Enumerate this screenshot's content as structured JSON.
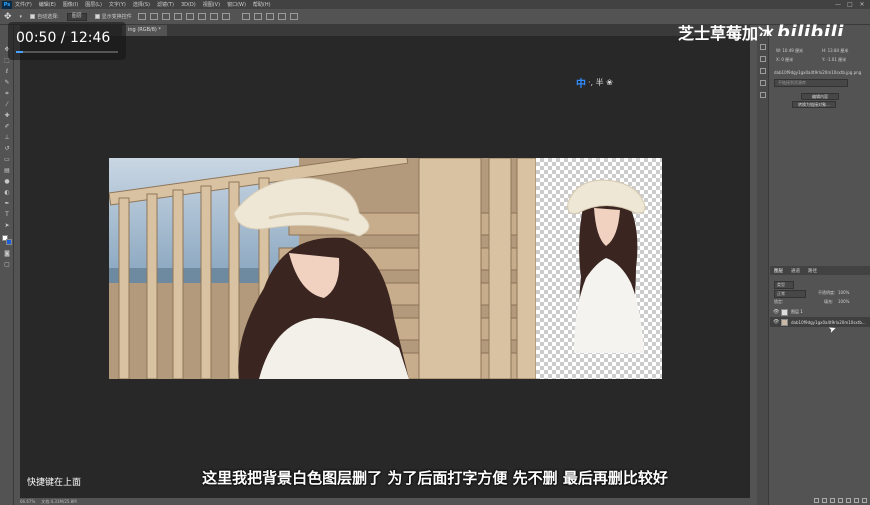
{
  "app": {
    "logo": "Ps"
  },
  "menu": [
    "文件(F)",
    "编辑(E)",
    "图像(I)",
    "图层(L)",
    "文字(Y)",
    "选择(S)",
    "滤镜(T)",
    "3D(D)",
    "视图(V)",
    "窗口(W)",
    "帮助(H)"
  ],
  "window_controls": [
    "—",
    "□",
    "✕"
  ],
  "options_bar": {
    "auto_select_label": "自动选择:",
    "auto_select_value": "图层",
    "transform_label": "显示变换控件"
  },
  "document_tab": "ing (RGB/8) *",
  "overlay": {
    "time": "00:50 / 12:46",
    "progress": 0.065,
    "watermark_name": "芝士草莓加冰",
    "watermark_logo": "bilibili",
    "ime_zh": "中",
    "ime_rest": "·, 半 ❀"
  },
  "subtitle": "这里我把背景白色图层删了 为了后面打字方便 先不删 最后再删比较好",
  "side_note": "快捷键在上面",
  "status_bar": {
    "zoom": "66.67%",
    "doc": "文档:4.31M/25.8M"
  },
  "properties_panel": {
    "w_label": "W: 10.49 厘米",
    "h_label": "H: 13.84 厘米",
    "x_label": "X: 0 厘米",
    "y_label": "Y: -1.01 厘米",
    "filename": "dab10f9dgy1gx0a4t9rlx20m10sxtb.jpg.png",
    "search_placeholder": "不链接到资源库",
    "btn_edit": "编辑内容",
    "btn_convert": "转换为链接对象..."
  },
  "layers_panel": {
    "tabs": [
      "图层",
      "通道",
      "路径"
    ],
    "filter_label": "类型",
    "blend_mode": "正常",
    "opacity_label": "不透明度:",
    "opacity_value": "100%",
    "lock_label": "锁定:",
    "fill_label": "填充:",
    "fill_value": "100%",
    "layers": [
      {
        "name": "图层 1"
      },
      {
        "name": "dab10f9dgy1gx0a4t9rlx20m10sxtb..."
      }
    ]
  }
}
